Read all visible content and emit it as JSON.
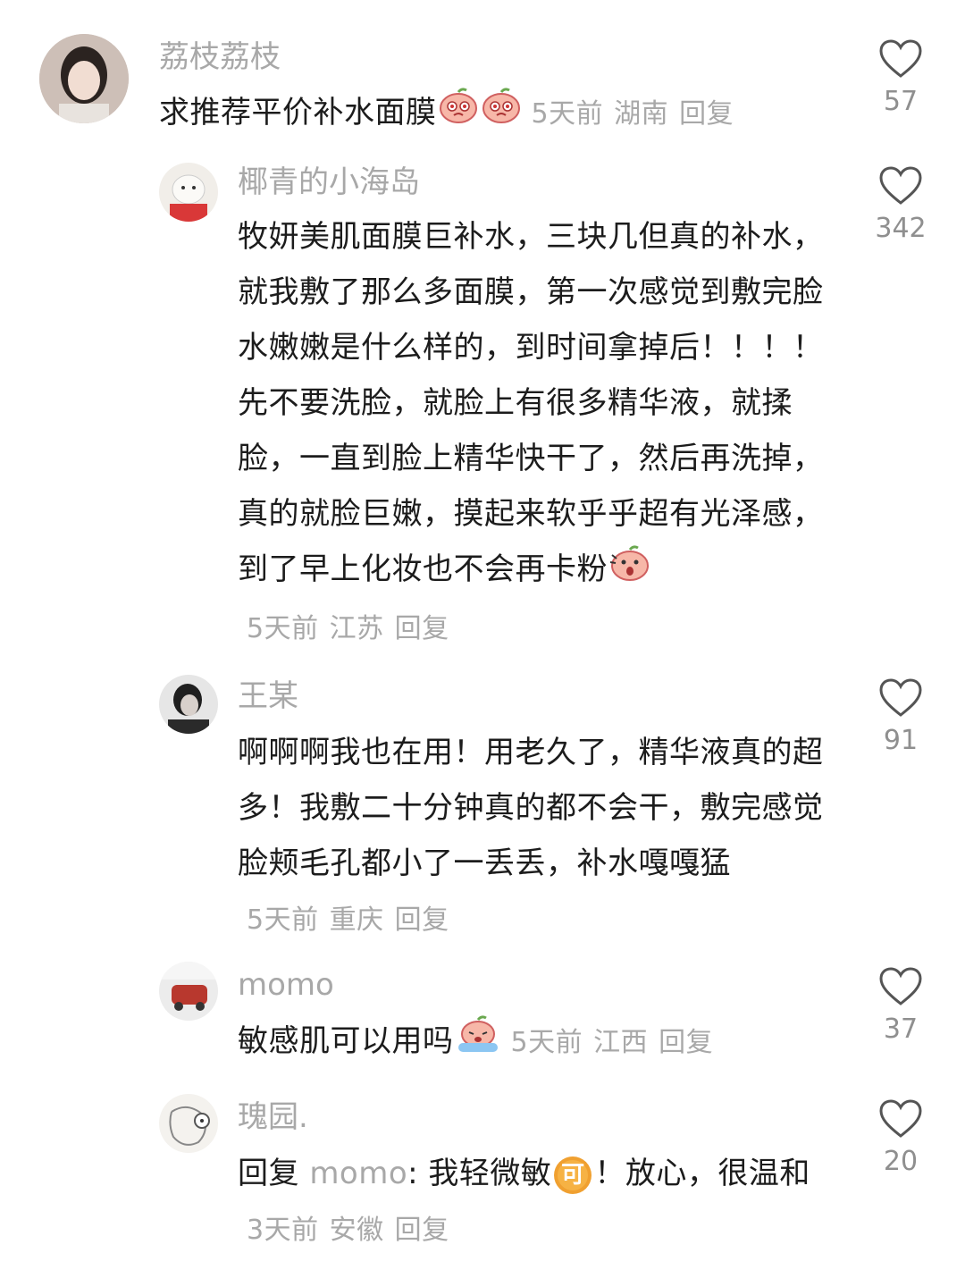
{
  "comments": [
    {
      "username": "荔枝荔枝",
      "text": "求推荐平价补水面膜",
      "emojis": [
        "peach-pleading-emoji",
        "peach-pleading-emoji"
      ],
      "time": "5天前",
      "location": "湖南",
      "reply_label": "回复",
      "likes": "57"
    },
    {
      "username": "椰青的小海岛",
      "text": "牧妍美肌面膜巨补水，三块几但真的补水，就我敷了那么多面膜，第一次感觉到敷完脸水嫩嫩是什么样的，到时间拿掉后！！！！先不要洗脸，就脸上有很多精华液，就揉脸，一直到脸上精华快干了，然后再洗掉，真的就脸巨嫩，摸起来软乎乎超有光泽感，到了早上化妆也不会再卡粉",
      "emojis": [
        "peach-shocked-emoji"
      ],
      "time": "5天前",
      "location": "江苏",
      "reply_label": "回复",
      "likes": "342"
    },
    {
      "username": "王某",
      "text": "啊啊啊我也在用！用老久了，精华液真的超多！我敷二十分钟真的都不会干，敷完感觉脸颊毛孔都小了一丢丢，补水嘎嘎猛",
      "time": "5天前",
      "location": "重庆",
      "reply_label": "回复",
      "likes": "91"
    },
    {
      "username": "momo",
      "text": "敏感肌可以用吗",
      "emojis": [
        "peach-crying-emoji"
      ],
      "time": "5天前",
      "location": "江西",
      "reply_label": "回复",
      "likes": "37"
    },
    {
      "username": "瑰园.",
      "reply_prefix": "回复",
      "reply_to": "momo",
      "text_before": ": 我轻微敏",
      "emoji_label": "可",
      "text_after": "！放心，很温和",
      "time": "3天前",
      "location": "安徽",
      "reply_label": "回复",
      "likes": "20"
    }
  ],
  "colors": {
    "text": "#1c1c1c",
    "muted": "#a8a8a8",
    "peach": "#f7b7a8",
    "badge": "#f0a030"
  }
}
